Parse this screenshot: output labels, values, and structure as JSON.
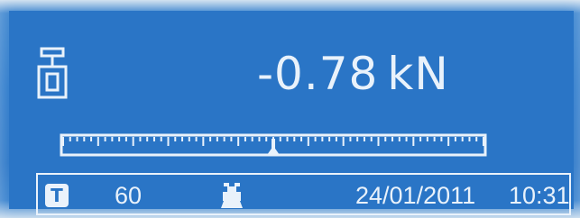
{
  "display": {
    "reading": "-0.78",
    "unit": "kN"
  },
  "bargraph": {
    "center_fraction": 0.5
  },
  "status_bar": {
    "tare_label": "T",
    "count": "60",
    "date": "24/01/2011",
    "time": "10:31"
  },
  "icons": {
    "weight": "weight-icon",
    "tare": "tare-icon",
    "printer": "printer-icon"
  },
  "colors": {
    "lcd_background": "#2a75c6",
    "foreground": "#e9f2fb"
  }
}
